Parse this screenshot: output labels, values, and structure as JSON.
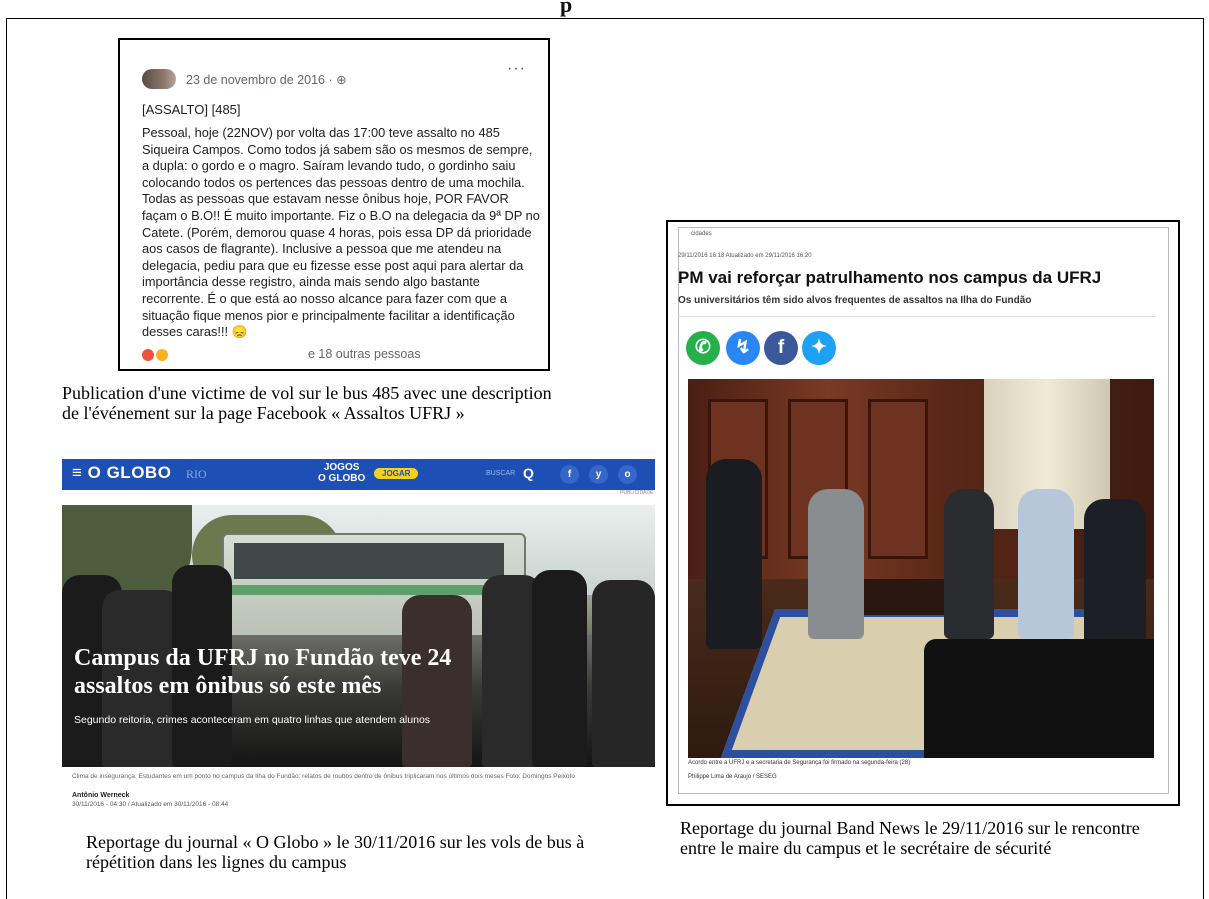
{
  "page_title": "p",
  "facebook": {
    "date": "23 de novembro de 2016 · ⊕",
    "more": "···",
    "tag": "[ASSALTO] [485]",
    "body": "Pessoal, hoje (22NOV) por volta das 17:00 teve assalto no 485 Siqueira Campos. Como todos já sabem são os mesmos de sempre, a dupla: o gordo e o magro. Saíram levando tudo, o gordinho saiu colocando todos os pertences das pessoas dentro de uma mochila. Todas as pessoas que estavam nesse ônibus hoje, POR FAVOR façam o B.O!! É muito importante. Fiz o B.O na delegacia da 9ª DP no Catete. (Porém, demorou quase 4 horas, pois essa DP dá prioridade aos casos de flagrante). Inclusive a pessoa que me atendeu na delegacia, pediu para que eu fizesse esse post aqui para alertar da importância desse registro, ainda mais sendo algo bastante recorrente. É o que está ao nosso alcance para fazer com que a situação fique menos pior e principalmente facilitar a identificação desses caras!!! 😞",
    "reactions": "e 18 outras pessoas",
    "reaction_colors": [
      "#f0523d",
      "#f7b125"
    ]
  },
  "caption_fb": "Publication d'une victime de vol sur le bus 485 avec une description de l'événement sur la page Facebook « Assaltos UFRJ »",
  "globo": {
    "logo": "≡ O GLOBO",
    "edition": "RIO",
    "jogos_line1": "JOGOS",
    "jogos_line2": "O GLOBO",
    "jogar": "JOGAR",
    "buscar": "BUSCAR",
    "search_icon": "Q",
    "socials": [
      "f",
      "y",
      "o"
    ],
    "publicidade": "PUBLICIDADE",
    "headline": "Campus da UFRJ no Fundão teve 24 assaltos em ônibus só este mês",
    "subhead": "Segundo reitoria, crimes aconteceram em quatro linhas que atendem alunos",
    "credit": "Clima de insegurança. Estudantes em um ponto no campus da Ilha do Fundão: relatos de roubos dentro de ônibus triplicaram nos últimos dois meses Foto: Domingos Peixoto",
    "author": "Antônio Werneck",
    "date": "30/11/2016 - 04:30 / Atualizado em 30/11/2016 - 08:44",
    "brand_color": "#1d4fb5"
  },
  "caption_globo": "Reportage du journal « O Globo » le 30/11/2016 sur les vols de bus à répétition dans les lignes du campus",
  "band": {
    "section": "cidades",
    "meta": "29/11/2016 16:18 Atualizado em 29/11/2016 16:20",
    "title": "PM vai reforçar patrulhamento nos campus da UFRJ",
    "subtitle": "Os universitários têm sido alvos frequentes de assaltos na Ilha do Fundão",
    "share_icons": [
      {
        "name": "whatsapp-icon",
        "glyph": "✆",
        "color": "#25b04a"
      },
      {
        "name": "messenger-icon",
        "glyph": "↯",
        "color": "#2a86f3"
      },
      {
        "name": "facebook-icon",
        "glyph": "f",
        "color": "#3b5998"
      },
      {
        "name": "twitter-icon",
        "glyph": "✦",
        "color": "#1da1f2"
      }
    ],
    "photo_caption": "Acordo entre a UFRJ e a secretaria de Segurança foi firmado na segunda-feira (28)",
    "photo_credit": "Philippe Lima de Araujo / SESEG"
  },
  "caption_band": "Reportage du journal Band News le 29/11/2016 sur le rencontre entre le maire du campus et le secrétaire de sécurité"
}
